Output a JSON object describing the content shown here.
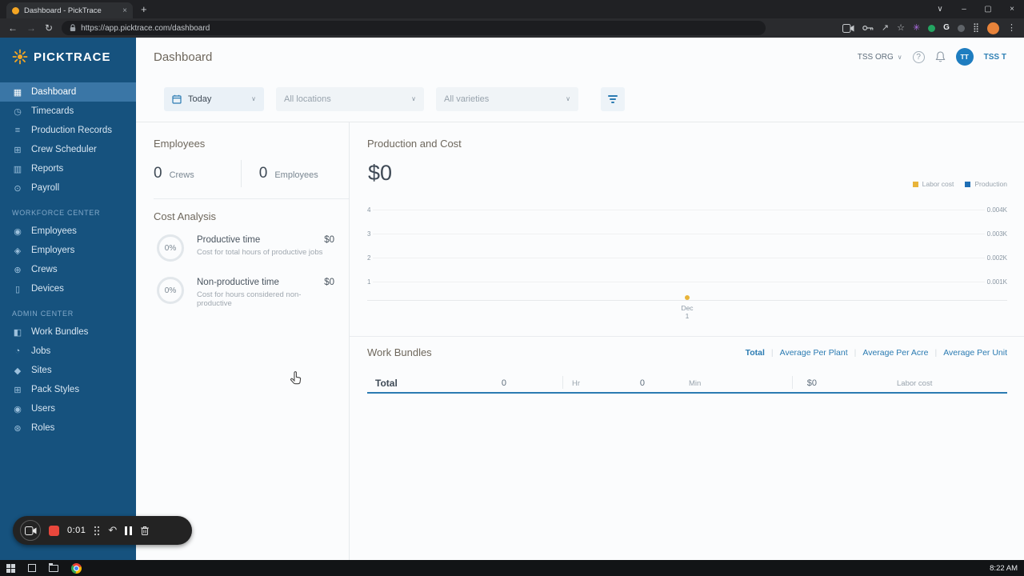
{
  "browser": {
    "tab": {
      "title": "Dashboard - PickTrace"
    },
    "url": "https://app.picktrace.com/dashboard"
  },
  "icons": {
    "dashboard": "▦",
    "timecards": "◷",
    "production_records": "≡",
    "crew_scheduler": "⊞",
    "reports": "▥",
    "payroll": "⊙",
    "employees": "◉",
    "employers": "◈",
    "crews": "⊕",
    "devices": "▯",
    "work_bundles": "◧",
    "jobs": "◔",
    "sites": "◆",
    "pack_styles": "⊞",
    "users": "◉",
    "roles": "⊛",
    "chevron_down": "∨",
    "close": "×",
    "plus": "+",
    "minimize": "–",
    "maximize": "▢",
    "back": "←",
    "forward": "→",
    "reload": "↻",
    "share": "↗",
    "star": "☆",
    "grid": "⣿",
    "menu_dots": "⋮",
    "extension_flower": "✳",
    "g_logo": "G",
    "undo": "↶"
  },
  "sidebar": {
    "logo_text": "PICKTRACE",
    "main_items": [
      {
        "label": "Dashboard",
        "icon": "dashboard",
        "active": true
      },
      {
        "label": "Timecards",
        "icon": "timecards"
      },
      {
        "label": "Production Records",
        "icon": "production_records"
      },
      {
        "label": "Crew Scheduler",
        "icon": "crew_scheduler"
      },
      {
        "label": "Reports",
        "icon": "reports"
      },
      {
        "label": "Payroll",
        "icon": "payroll"
      }
    ],
    "sections": [
      {
        "label": "WORKFORCE CENTER",
        "items": [
          {
            "label": "Employees",
            "icon": "employees"
          },
          {
            "label": "Employers",
            "icon": "employers"
          },
          {
            "label": "Crews",
            "icon": "crews"
          },
          {
            "label": "Devices",
            "icon": "devices"
          }
        ]
      },
      {
        "label": "ADMIN CENTER",
        "items": [
          {
            "label": "Work Bundles",
            "icon": "work_bundles"
          },
          {
            "label": "Jobs",
            "icon": "jobs"
          },
          {
            "label": "Sites",
            "icon": "sites"
          },
          {
            "label": "Pack Styles",
            "icon": "pack_styles"
          },
          {
            "label": "Users",
            "icon": "users"
          },
          {
            "label": "Roles",
            "icon": "roles"
          }
        ]
      }
    ]
  },
  "header": {
    "title": "Dashboard",
    "org_label": "TSS ORG",
    "help_label": "?",
    "avatar_initials": "TT",
    "user_label": "TSS T"
  },
  "filters": {
    "date_value": "Today",
    "locations_placeholder": "All locations",
    "varieties_placeholder": "All varieties"
  },
  "employees_panel": {
    "title": "Employees",
    "crews_value": "0",
    "crews_label": "Crews",
    "employees_value": "0",
    "employees_label": "Employees"
  },
  "cost_analysis": {
    "title": "Cost Analysis",
    "items": [
      {
        "percent": "0%",
        "label": "Productive time",
        "description": "Cost for total hours of productive jobs",
        "value": "$0"
      },
      {
        "percent": "0%",
        "label": "Non-productive time",
        "description": "Cost for hours considered non-productive",
        "value": "$0"
      }
    ]
  },
  "production": {
    "title": "Production and Cost",
    "total": "$0",
    "legend": [
      {
        "label": "Labor cost",
        "color": "#E8B43A"
      },
      {
        "label": "Production",
        "color": "#1F6FB5"
      }
    ]
  },
  "chart_data": {
    "type": "line",
    "title": "Production and Cost",
    "x_categories": [
      "Dec 1"
    ],
    "series": [
      {
        "name": "Labor cost",
        "color": "#E8B43A",
        "values": [
          0
        ]
      },
      {
        "name": "Production",
        "color": "#1F6FB5",
        "values": [
          0
        ]
      }
    ],
    "left_axis_ticks": [
      "4",
      "3",
      "2",
      "1"
    ],
    "right_axis_ticks": [
      "0.004K",
      "0.003K",
      "0.002K",
      "0.001K"
    ],
    "x_tick_lines": [
      "Dec",
      "1"
    ],
    "grid": true,
    "legend_position": "top-right"
  },
  "work_bundles": {
    "title": "Work Bundles",
    "tabs": [
      "Total",
      "Average Per Plant",
      "Average Per Acre",
      "Average Per Unit"
    ],
    "active_tab": "Total",
    "row": {
      "label": "Total",
      "hours_value": "0",
      "hours_unit": "Hr",
      "minutes_value": "0",
      "minutes_unit": "Min",
      "cost_value": "$0",
      "cost_label": "Labor cost"
    }
  },
  "recorder": {
    "time": "0:01"
  },
  "taskbar": {
    "time": "8:22 AM"
  }
}
